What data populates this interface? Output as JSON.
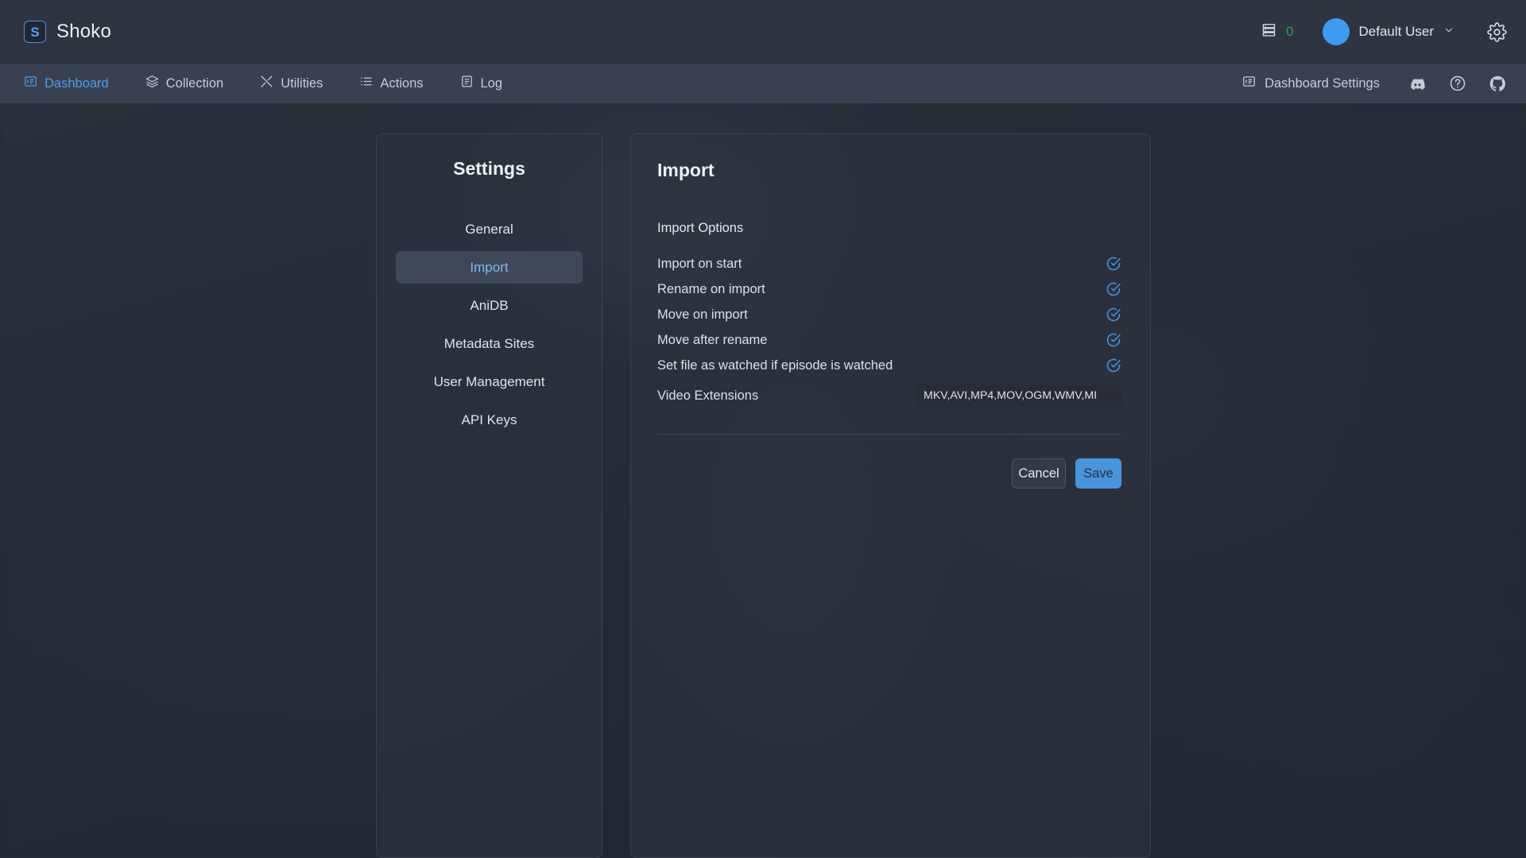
{
  "header": {
    "logo_letter": "S",
    "app_name": "Shoko",
    "queue_icon": "server-stack-icon",
    "queue_count": "0",
    "avatar_icon": "avatar",
    "user_name": "Default User",
    "user_chevron_icon": "chevron-down-icon",
    "settings_gear_icon": "gear-icon",
    "accent_color": "#4f9beb",
    "queue_count_color": "#2f9b5c"
  },
  "navbar": {
    "items": [
      {
        "label": "Dashboard",
        "icon": "dashboard-icon",
        "active": true
      },
      {
        "label": "Collection",
        "icon": "layers-icon",
        "active": false
      },
      {
        "label": "Utilities",
        "icon": "tools-icon",
        "active": false
      },
      {
        "label": "Actions",
        "icon": "list-icon",
        "active": false
      },
      {
        "label": "Log",
        "icon": "document-icon",
        "active": false
      }
    ],
    "right": {
      "dashboard_settings_label": "Dashboard Settings",
      "dashboard_settings_icon": "dashboard-settings-icon",
      "discord_icon": "discord-icon",
      "help_icon": "question-circle-icon",
      "github_icon": "github-icon"
    }
  },
  "settings_panel": {
    "title": "Settings",
    "items": [
      {
        "label": "General",
        "active": false
      },
      {
        "label": "Import",
        "active": true
      },
      {
        "label": "AniDB",
        "active": false
      },
      {
        "label": "Metadata Sites",
        "active": false
      },
      {
        "label": "User Management",
        "active": false
      },
      {
        "label": "API Keys",
        "active": false
      }
    ]
  },
  "import_panel": {
    "heading": "Import",
    "section_label": "Import Options",
    "options": [
      {
        "label": "Import on start",
        "checked": true,
        "icon": "check-circle-icon"
      },
      {
        "label": "Rename on import",
        "checked": true,
        "icon": "check-circle-icon"
      },
      {
        "label": "Move on import",
        "checked": true,
        "icon": "check-circle-icon"
      },
      {
        "label": "Move after rename",
        "checked": true,
        "icon": "check-circle-icon"
      },
      {
        "label": "Set file as watched if episode is watched",
        "checked": true,
        "icon": "check-circle-icon"
      }
    ],
    "video_extensions": {
      "label": "Video Extensions",
      "value": "MKV,AVI,MP4,MOV,OGM,WMV,MI",
      "placeholder": "Video Extensions"
    },
    "buttons": {
      "cancel_label": "Cancel",
      "save_label": "Save"
    }
  }
}
